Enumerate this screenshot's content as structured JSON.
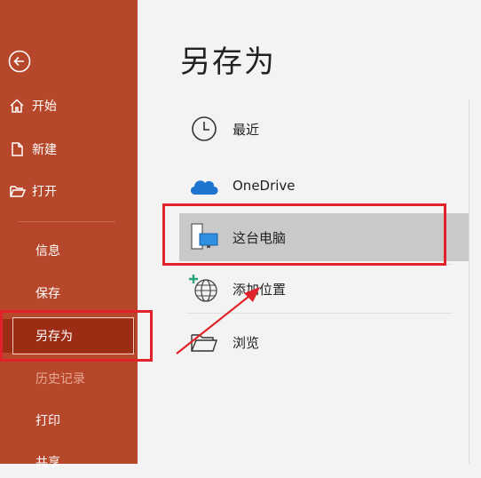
{
  "sidebar": {
    "items": [
      {
        "label": "开始",
        "icon": "home-icon"
      },
      {
        "label": "新建",
        "icon": "new-document-icon"
      },
      {
        "label": "打开",
        "icon": "open-folder-icon"
      },
      {
        "label": "信息"
      },
      {
        "label": "保存"
      },
      {
        "label": "另存为"
      },
      {
        "label": "历史记录"
      },
      {
        "label": "打印"
      },
      {
        "label": "共享"
      }
    ]
  },
  "main": {
    "title": "另存为",
    "locations": [
      {
        "label": "最近",
        "icon": "clock-icon"
      },
      {
        "label": "OneDrive",
        "icon": "cloud-icon"
      },
      {
        "label": "这台电脑",
        "icon": "computer-icon"
      },
      {
        "label": "添加位置",
        "icon": "add-location-icon"
      },
      {
        "label": "浏览",
        "icon": "folder-icon"
      }
    ]
  },
  "colors": {
    "sidebar": "#b7472a",
    "sidebar_selected": "#9c2d14",
    "highlight": "#e0232b",
    "location_selected": "#c9c9c9"
  }
}
